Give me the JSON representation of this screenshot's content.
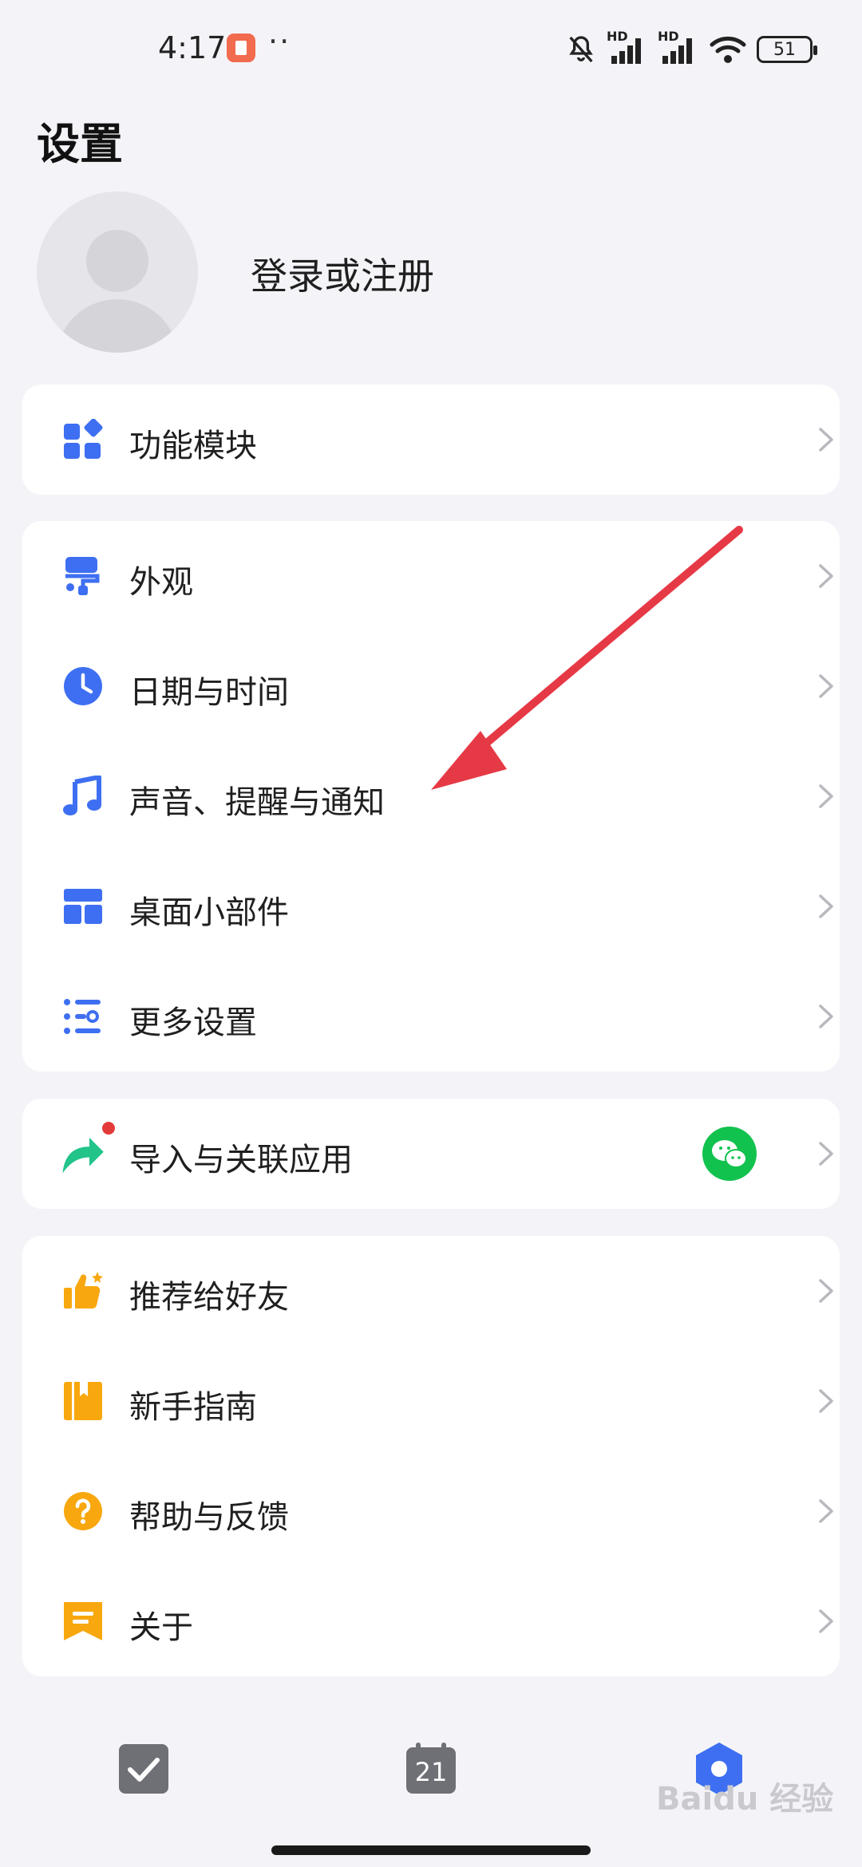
{
  "status_bar": {
    "time": "4:17",
    "dots": "··",
    "battery": "51",
    "net_label_1": "HD",
    "net_label_2": "HD"
  },
  "header": {
    "title": "设置"
  },
  "profile": {
    "login_label": "登录或注册"
  },
  "groups": {
    "modules": {
      "label": "功能模块",
      "icon": "grid-icon",
      "color": "#3e6ff2"
    },
    "appearance": {
      "label": "外观",
      "icon": "paint-roller-icon",
      "color": "#3e6ff2"
    },
    "datetime": {
      "label": "日期与时间",
      "icon": "clock-icon",
      "color": "#3e6ff2"
    },
    "sound": {
      "label": "声音、提醒与通知",
      "icon": "music-note-icon",
      "color": "#3e6ff2"
    },
    "widgets": {
      "label": "桌面小部件",
      "icon": "widget-layout-icon",
      "color": "#3e6ff2"
    },
    "more": {
      "label": "更多设置",
      "icon": "list-settings-icon",
      "color": "#3e6ff2"
    },
    "import": {
      "label": "导入与关联应用",
      "icon": "share-arrow-icon",
      "color": "#22c48a"
    },
    "recommend": {
      "label": "推荐给好友",
      "icon": "thumbs-up-icon",
      "color": "#f8a70e"
    },
    "guide": {
      "label": "新手指南",
      "icon": "book-icon",
      "color": "#f8a70e"
    },
    "help": {
      "label": "帮助与反馈",
      "icon": "question-icon",
      "color": "#f8a70e"
    },
    "about": {
      "label": "关于",
      "icon": "bookmark-icon",
      "color": "#f8a70e"
    }
  },
  "tabbar": {
    "calendar_day": "21",
    "tabs": [
      "task-check-icon",
      "calendar-icon",
      "settings-hex-icon"
    ]
  },
  "watermark": "Baidu 经验",
  "colors": {
    "background": "#f4f4f8",
    "card": "#ffffff",
    "accent_blue": "#3e6ff2",
    "annotation_red": "#e63946"
  }
}
